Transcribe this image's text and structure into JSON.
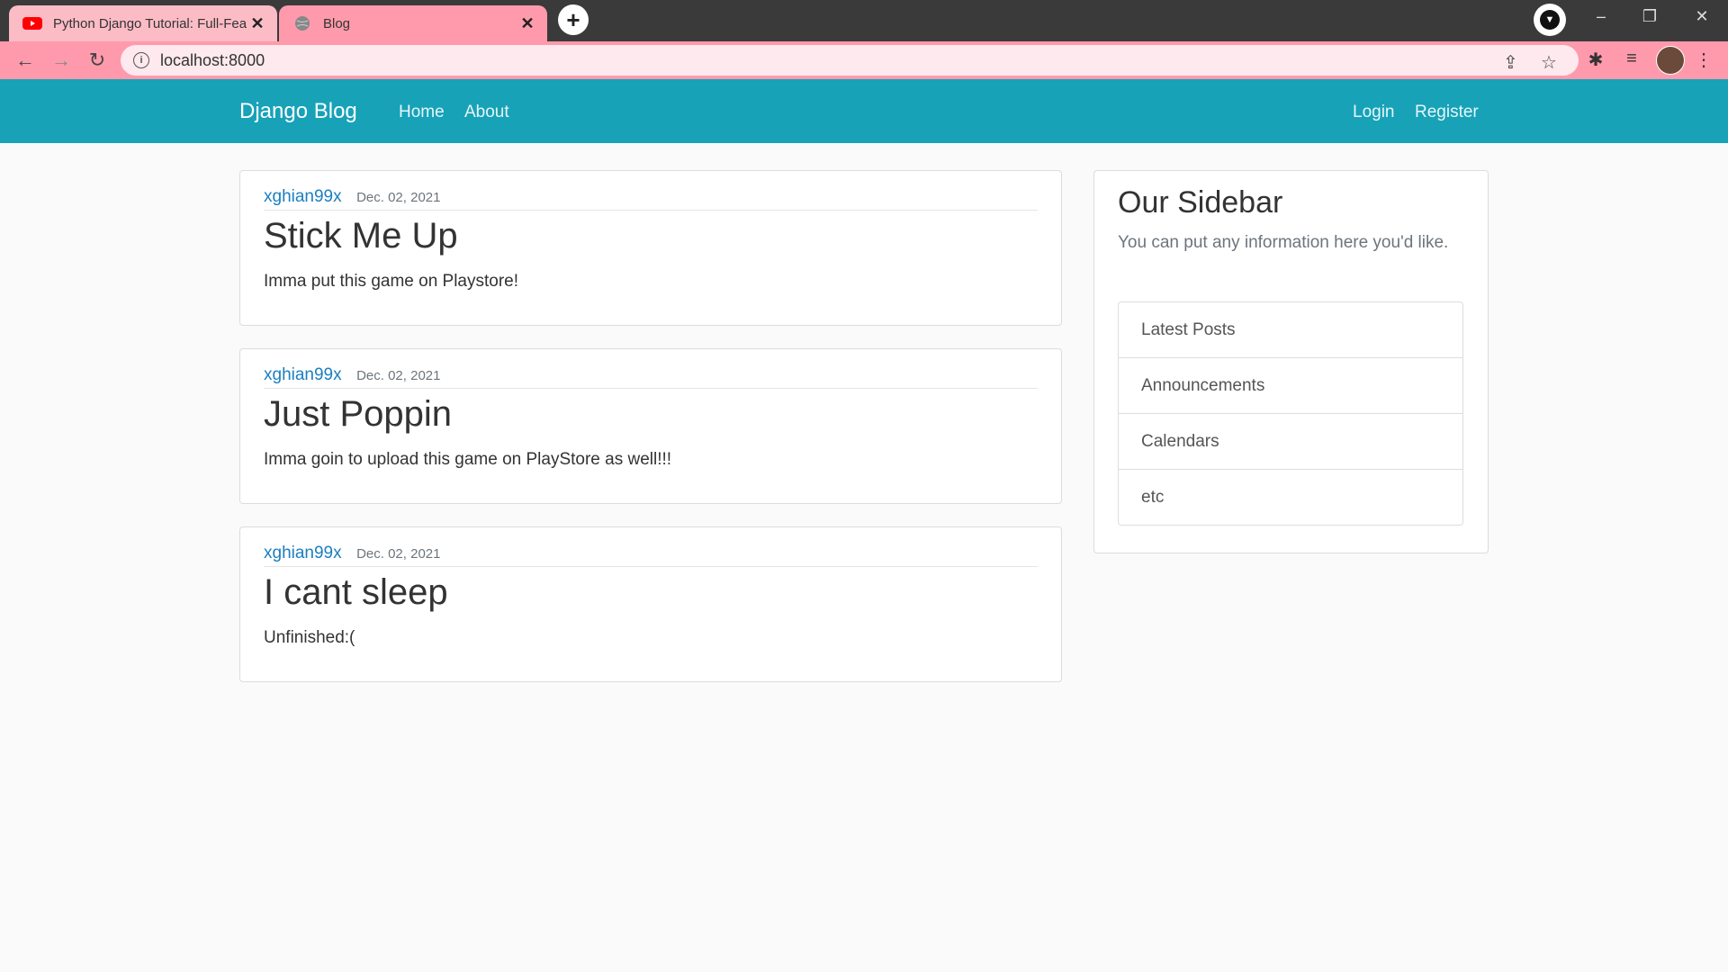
{
  "browser": {
    "tabs": [
      {
        "title": "Python Django Tutorial: Full-Feat"
      },
      {
        "title": "Blog"
      }
    ],
    "url": "localhost:8000"
  },
  "navbar": {
    "brand": "Django Blog",
    "links": [
      "Home",
      "About"
    ],
    "right_links": [
      "Login",
      "Register"
    ]
  },
  "posts": [
    {
      "author": "xghian99x",
      "date": "Dec. 02, 2021",
      "title": "Stick Me Up",
      "content": "Imma put this game on Playstore!"
    },
    {
      "author": "xghian99x",
      "date": "Dec. 02, 2021",
      "title": "Just Poppin",
      "content": "Imma goin to upload this game on PlayStore as well!!!"
    },
    {
      "author": "xghian99x",
      "date": "Dec. 02, 2021",
      "title": "I cant sleep",
      "content": "Unfinished:("
    }
  ],
  "sidebar": {
    "title": "Our Sidebar",
    "description": "You can put any information here you'd like.",
    "items": [
      "Latest Posts",
      "Announcements",
      "Calendars",
      "etc"
    ]
  },
  "colors": {
    "navbar": "#17a2b8",
    "tabstrip": "#3a3a3a",
    "toolbar": "#ff9aac",
    "link": "#1a7fc1"
  }
}
